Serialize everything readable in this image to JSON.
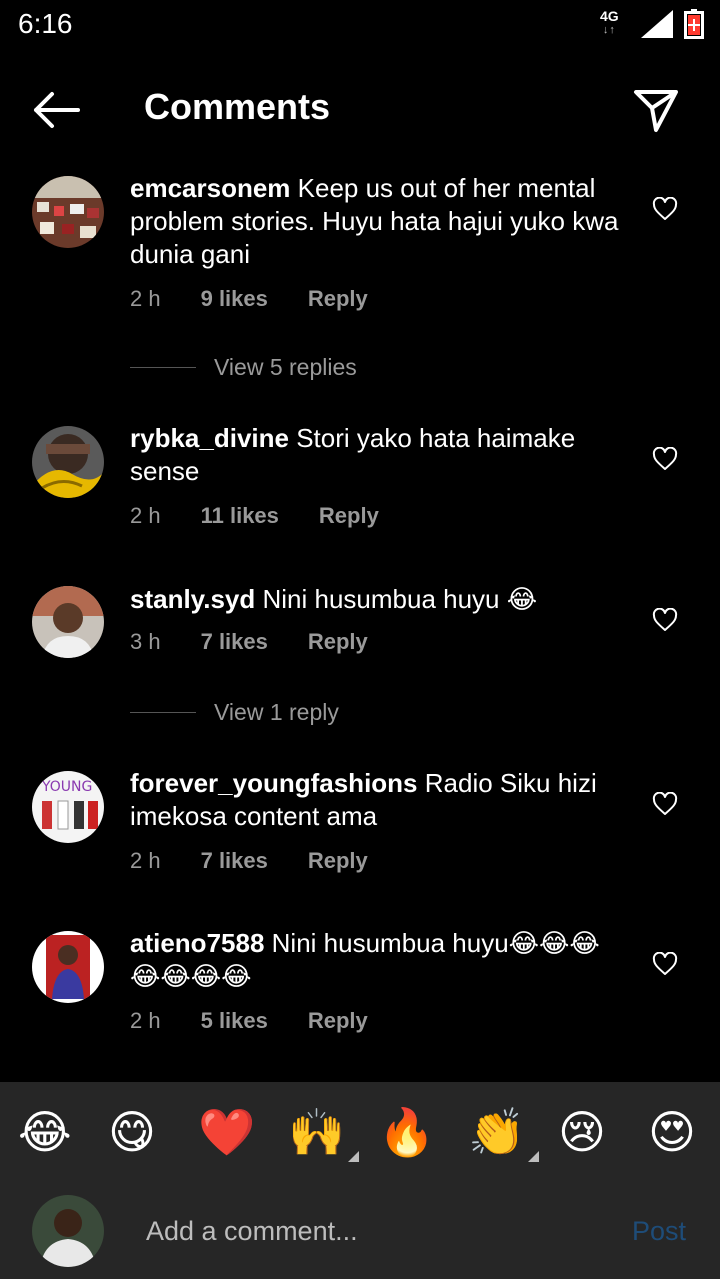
{
  "status": {
    "time": "6:16",
    "network": "4G",
    "arrows": "↓↑",
    "battery_color": "#ff3b30"
  },
  "header": {
    "title": "Comments"
  },
  "comments": [
    {
      "username": "emcarsonem",
      "text": "Keep us out of her mental problem stories. Huyu hata hajui yuko kwa dunia gani",
      "time": "2 h",
      "likes": "9 likes",
      "reply": "Reply"
    },
    {
      "username": "rybka_divine",
      "text": "Stori yako hata haimake sense",
      "time": "2 h",
      "likes": "11 likes",
      "reply": "Reply"
    },
    {
      "username": "stanly.syd",
      "text": "Nini husumbua huyu 😂",
      "time": "3 h",
      "likes": "7 likes",
      "reply": "Reply"
    },
    {
      "username": "forever_youngfashions",
      "text": "Radio Siku hizi imekosa content ama",
      "time": "2 h",
      "likes": "7 likes",
      "reply": "Reply"
    },
    {
      "username": "atieno7588",
      "text": "Nini husumbua huyu😂😂😂😂😂😂😂",
      "time": "2 h",
      "likes": "5 likes",
      "reply": "Reply"
    }
  ],
  "view_replies": [
    "View 5 replies",
    "View 1 reply"
  ],
  "emoji_bar": [
    "😂",
    "😋",
    "❤️",
    "🙌",
    "🔥",
    "👏",
    "😢",
    "😍"
  ],
  "compose": {
    "placeholder": "Add a comment...",
    "post_label": "Post"
  },
  "colors": {
    "background": "#000000",
    "secondary_text": "#9a9a9a",
    "panel": "#262626",
    "post_disabled": "#1e4c78"
  }
}
